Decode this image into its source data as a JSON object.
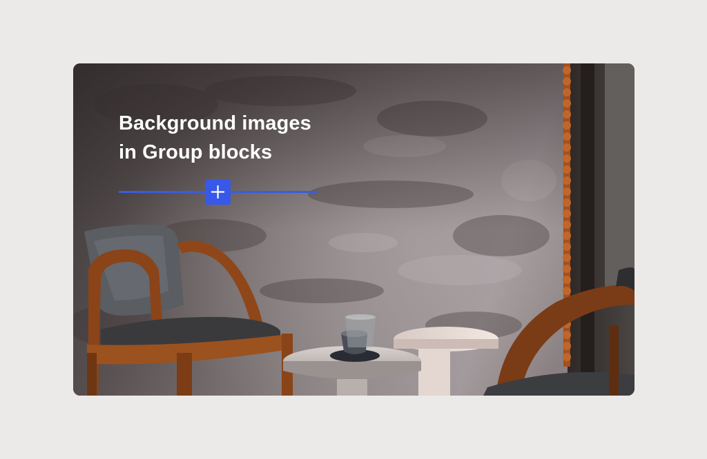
{
  "card": {
    "heading_line1": "Background images",
    "heading_line2": "in Group blocks",
    "image_subject": "cafe interior with wooden chairs and round stone tables"
  },
  "inserter": {
    "icon": "plus-icon",
    "accent_color": "#3858e9"
  }
}
